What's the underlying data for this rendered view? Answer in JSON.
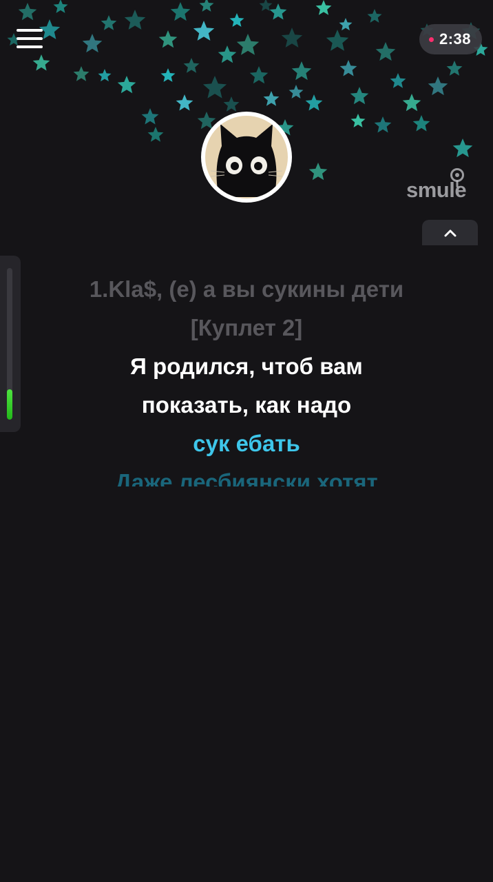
{
  "header": {
    "timer": "2:38"
  },
  "brand": {
    "logo_text": "smule"
  },
  "icons": {
    "menu": "hamburger-menu-icon",
    "collapse": "chevron-up-icon",
    "logo_mic": "microphone-icon",
    "recording": "recording-dot"
  },
  "lyrics": {
    "lines": [
      {
        "text": "1.Kla$, (е) а вы сукины дети",
        "state": "past"
      },
      {
        "text": "[Куплет 2]",
        "state": "past"
      },
      {
        "text": "Я родился, чтоб вам",
        "state": "current"
      },
      {
        "text": "показать, как надо",
        "state": "current"
      },
      {
        "text": "сук ебать",
        "state": "active"
      },
      {
        "text": "Даже лесбиянски хотят",
        "state": "next"
      }
    ]
  },
  "pitch_meter": {
    "level": 0.2
  },
  "colors": {
    "background": "#151417",
    "accent_blue": "#3ec6ea",
    "recording_dot": "#ff2e6e",
    "meter_green": "#35d02a",
    "past_lyric": "#58575c"
  }
}
